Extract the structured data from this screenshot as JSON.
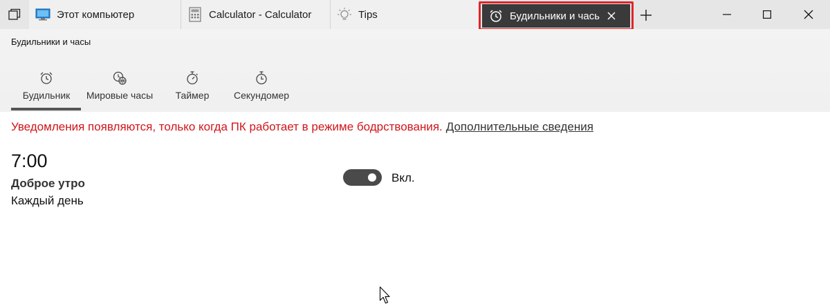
{
  "tabs": [
    {
      "title": "Этот компьютер",
      "icon": "monitor-icon"
    },
    {
      "title": "Calculator - Calculator",
      "icon": "calculator-icon"
    },
    {
      "title": "Tips",
      "icon": "lightbulb-icon"
    }
  ],
  "active_tab": {
    "title": "Будильники и часы",
    "icon": "alarm-clock-icon"
  },
  "window_controls": {
    "minimize": "minimize-icon",
    "maximize": "maximize-icon",
    "close": "close-icon"
  },
  "app": {
    "title": "Будильники и часы",
    "nav": [
      {
        "label": "Будильник",
        "icon": "alarm-clock-icon",
        "selected": true
      },
      {
        "label": "Мировые часы",
        "icon": "world-clock-icon",
        "selected": false
      },
      {
        "label": "Таймер",
        "icon": "timer-icon",
        "selected": false
      },
      {
        "label": "Секундомер",
        "icon": "stopwatch-icon",
        "selected": false
      }
    ]
  },
  "notice": {
    "text": "Уведомления появляются, только когда ПК работает в режиме бодрствования.",
    "link": "Дополнительные сведения"
  },
  "alarm": {
    "time": "7:00",
    "name": "Доброе утро",
    "repeat": "Каждый день",
    "toggle_label": "Вкл.",
    "enabled": true
  },
  "colors": {
    "notice": "#d0151b",
    "highlight": "#e0242b",
    "active_tab_bg": "#3a3a3a",
    "tabbar_bg": "#e6e6e6"
  }
}
